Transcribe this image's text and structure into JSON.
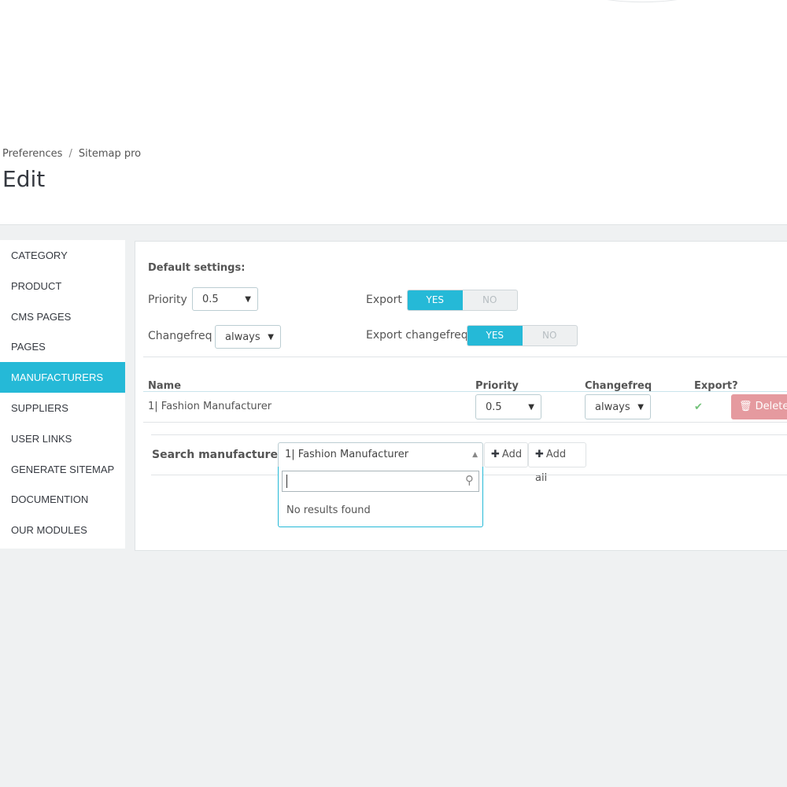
{
  "breadcrumb": {
    "parent": "Preferences",
    "separator": "/",
    "current": "Sitemap pro"
  },
  "page_title": "Edit",
  "sidebar": {
    "items": [
      {
        "label": "CATEGORY"
      },
      {
        "label": "PRODUCT"
      },
      {
        "label": "CMS PAGES"
      },
      {
        "label": "PAGES"
      },
      {
        "label": "MANUFACTURERS",
        "active": true
      },
      {
        "label": "SUPPLIERS"
      },
      {
        "label": "USER LINKS"
      },
      {
        "label": "GENERATE SITEMAP"
      },
      {
        "label": "DOCUMENTION"
      },
      {
        "label": "OUR MODULES"
      }
    ]
  },
  "defaults": {
    "heading": "Default settings:",
    "priority_label": "Priority",
    "priority_value": "0.5",
    "changefreq_label": "Changefreq",
    "changefreq_value": "always",
    "export_label": "Export",
    "export_changefreq_label": "Export changefreq",
    "yes": "YES",
    "no": "NO"
  },
  "table": {
    "headers": {
      "name": "Name",
      "priority": "Priority",
      "changefreq": "Changefreq",
      "export": "Export?"
    },
    "row": {
      "name": "1| Fashion Manufacturer",
      "priority": "0.5",
      "changefreq": "always",
      "delete": "Delete"
    }
  },
  "search": {
    "label": "Search manufacturer:",
    "selected": "1| Fashion Manufacturer",
    "add": "Add",
    "add_all": "Add all",
    "no_results": "No results found"
  },
  "colors": {
    "accent": "#25b9d7",
    "delete": "#e59a9f",
    "check": "#72c279"
  }
}
